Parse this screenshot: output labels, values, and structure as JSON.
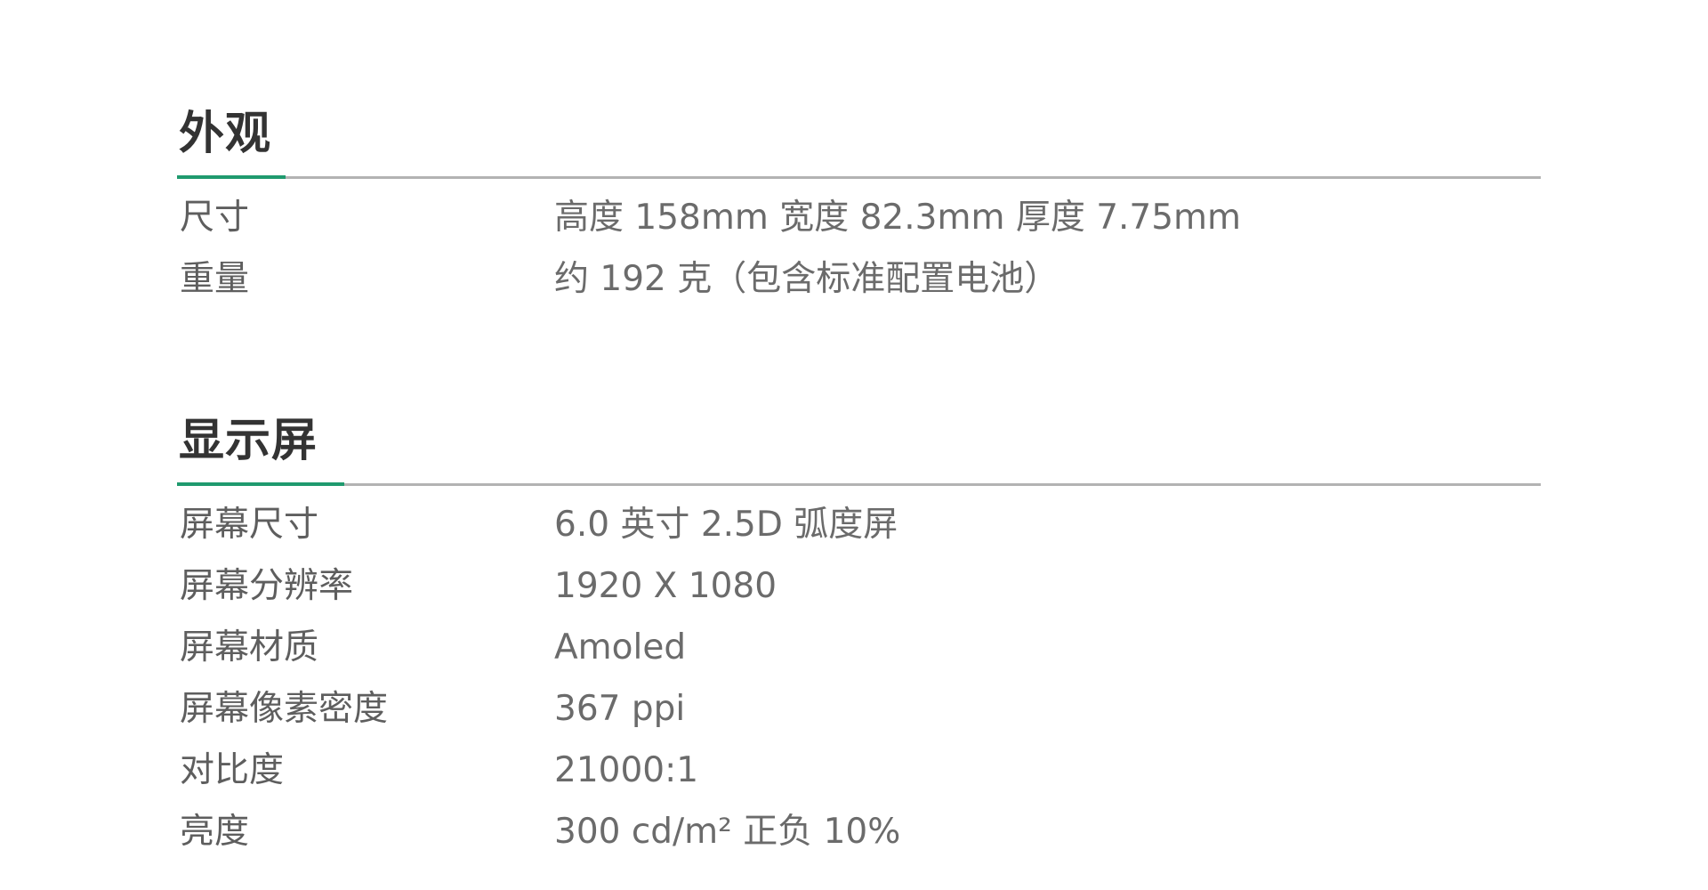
{
  "sections": [
    {
      "title": "外观",
      "rows": [
        {
          "label": "尺寸",
          "value": "高度 158mm 宽度 82.3mm 厚度 7.75mm"
        },
        {
          "label": "重量",
          "value": "约 192 克（包含标准配置电池）"
        }
      ]
    },
    {
      "title": "显示屏",
      "rows": [
        {
          "label": "屏幕尺寸",
          "value": "6.0 英寸 2.5D 弧度屏"
        },
        {
          "label": "屏幕分辨率",
          "value": "1920 X 1080"
        },
        {
          "label": "屏幕材质",
          "value": "Amoled"
        },
        {
          "label": "屏幕像素密度",
          "value": "367 ppi"
        },
        {
          "label": "对比度",
          "value": "21000:1"
        },
        {
          "label": "亮度",
          "value": "300 cd/m²  正负 10%"
        }
      ]
    }
  ],
  "colors": {
    "accent": "#1f9a6e",
    "divider": "#b3b3b3",
    "title": "#333333",
    "label": "#5e5e5e",
    "value": "#6b6b6b"
  }
}
